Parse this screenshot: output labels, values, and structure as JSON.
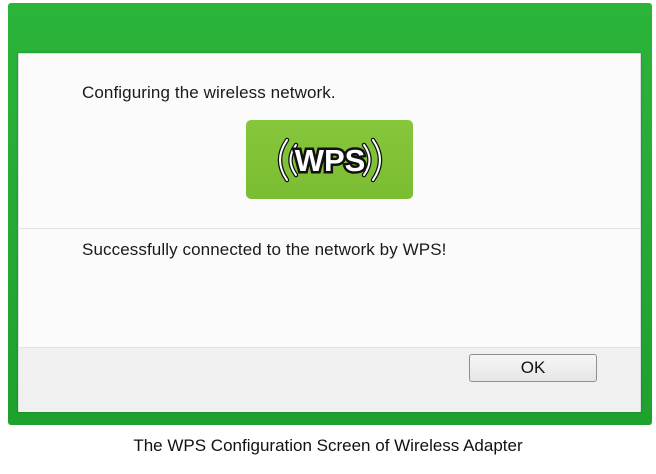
{
  "dialog": {
    "status_top": "Configuring the wireless network.",
    "status_result": "Successfully connected to the network by WPS!",
    "ok_label": "OK"
  },
  "wps_badge": {
    "text": "WPS",
    "icon": "wps-icon",
    "background_color": "#7cbd34"
  },
  "frame_color": "#22a831",
  "caption": "The WPS Configuration Screen of Wireless Adapter"
}
